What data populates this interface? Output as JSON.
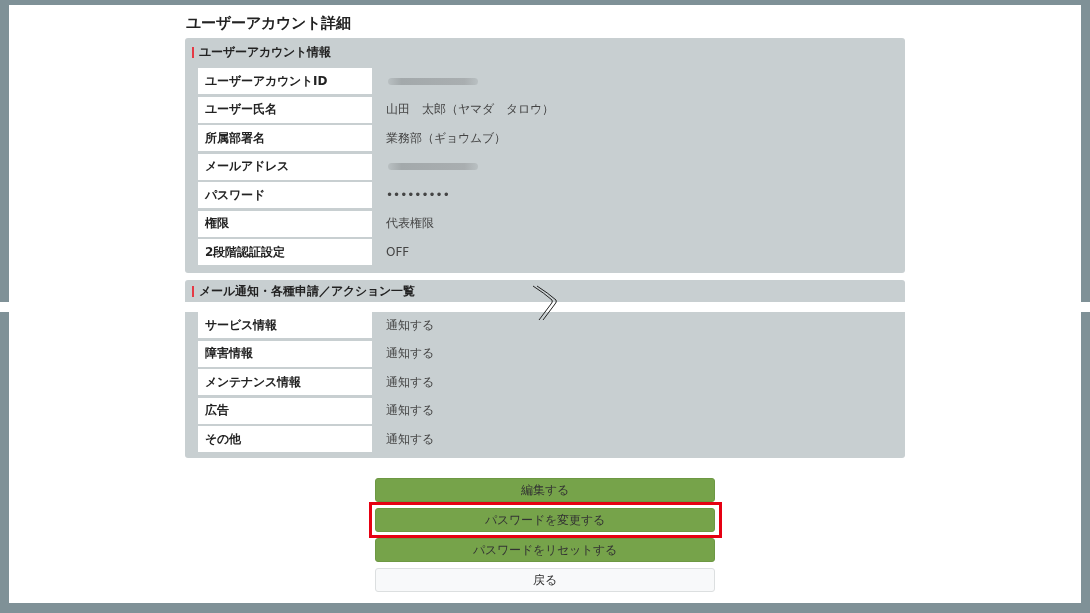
{
  "page": {
    "title": "ユーザーアカウント詳細"
  },
  "sections": [
    {
      "heading": "ユーザーアカウント情報",
      "split": false,
      "rows": [
        {
          "label": "ユーザーアカウントID",
          "kind": "blurred"
        },
        {
          "label": "ユーザー氏名",
          "kind": "text",
          "value": "山田　太郎（ヤマダ　タロウ）"
        },
        {
          "label": "所属部署名",
          "kind": "text",
          "value": "業務部（ギョウムブ）"
        },
        {
          "label": "メールアドレス",
          "kind": "blurred"
        },
        {
          "label": "パスワード",
          "kind": "text",
          "value": "•••••••••"
        },
        {
          "label": "権限",
          "kind": "text",
          "value": "代表権限"
        },
        {
          "label": "2段階認証設定",
          "kind": "text",
          "value": "OFF"
        }
      ]
    },
    {
      "heading": "メール通知・各種申請／アクション一覧",
      "split": true,
      "rows": [
        {
          "label": "サービス情報",
          "kind": "text",
          "value": "通知する"
        },
        {
          "label": "障害情報",
          "kind": "text",
          "value": "通知する"
        },
        {
          "label": "メンテナンス情報",
          "kind": "text",
          "value": "通知する"
        },
        {
          "label": "広告",
          "kind": "text",
          "value": "通知する"
        },
        {
          "label": "その他",
          "kind": "text",
          "value": "通知する"
        }
      ]
    }
  ],
  "buttons": [
    {
      "label": "編集する",
      "kind": "primary",
      "highlighted": false
    },
    {
      "label": "パスワードを変更する",
      "kind": "primary",
      "highlighted": true
    },
    {
      "label": "パスワードをリセットする",
      "kind": "primary",
      "highlighted": false
    },
    {
      "label": "戻る",
      "kind": "secondary",
      "highlighted": false
    }
  ]
}
